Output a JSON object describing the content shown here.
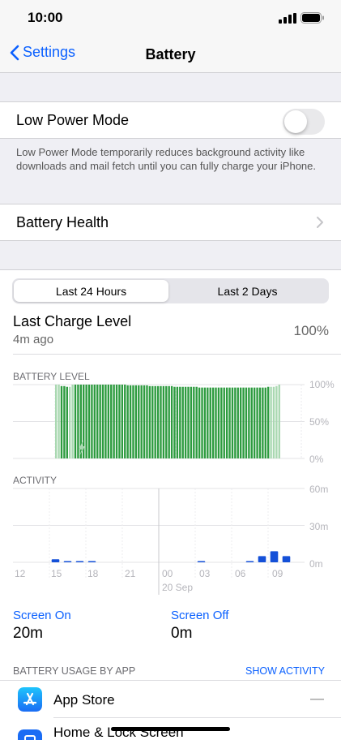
{
  "status_bar": {
    "time": "10:00"
  },
  "nav": {
    "back_label": "Settings",
    "title": "Battery"
  },
  "low_power": {
    "label": "Low Power Mode",
    "enabled": false,
    "footnote": "Low Power Mode temporarily reduces background activity like downloads and mail fetch until you can fully charge your iPhone."
  },
  "battery_health": {
    "label": "Battery Health"
  },
  "segment": {
    "options": [
      "Last 24 Hours",
      "Last 2 Days"
    ],
    "selected": 0
  },
  "last_charge": {
    "label": "Last Charge Level",
    "ago": "4m ago",
    "value": "100%"
  },
  "battery_level_chart": {
    "title": "BATTERY LEVEL",
    "y_ticks": [
      "100%",
      "50%",
      "0%"
    ],
    "levels_pct": [
      100,
      100,
      98,
      98,
      97,
      97,
      100,
      100,
      100,
      100,
      100,
      100,
      100,
      100,
      100,
      100,
      100,
      100,
      100,
      100,
      100,
      100,
      100,
      100,
      100,
      100,
      99,
      99,
      99,
      99,
      99,
      99,
      99,
      99,
      98,
      98,
      98,
      98,
      98,
      98,
      98,
      98,
      98,
      97,
      97,
      97,
      97,
      97,
      97,
      97,
      97,
      97,
      96,
      96,
      96,
      96,
      96,
      96,
      96,
      96,
      96,
      96,
      96,
      96,
      96,
      96,
      96,
      96,
      96,
      96,
      96,
      96,
      96,
      96,
      96,
      96,
      96,
      97,
      97,
      97,
      98,
      100
    ],
    "charging_segments": [
      [
        0,
        1
      ],
      [
        5,
        6
      ],
      [
        78,
        81
      ]
    ]
  },
  "activity_chart": {
    "title": "ACTIVITY",
    "y_ticks": [
      "60m",
      "30m",
      "0m"
    ],
    "x_ticks": [
      "12",
      "15",
      "18",
      "21",
      "00",
      "03",
      "06",
      "09"
    ],
    "date_label": "20 Sep",
    "ymax_minutes": 60,
    "hours": [
      "12",
      "13",
      "14",
      "15",
      "16",
      "17",
      "18",
      "19",
      "20",
      "21",
      "22",
      "23",
      "00",
      "01",
      "02",
      "03",
      "04",
      "05",
      "06",
      "07",
      "08",
      "09",
      "10"
    ],
    "screen_on_minutes": [
      0,
      0,
      0,
      2.5,
      1,
      1,
      1,
      0,
      0,
      0,
      0,
      0,
      0,
      0,
      0,
      1,
      0,
      0,
      0,
      1,
      5,
      9,
      5
    ]
  },
  "screen_time": {
    "on_label": "Screen On",
    "on_value": "20m",
    "off_label": "Screen Off",
    "off_value": "0m"
  },
  "usage": {
    "title": "BATTERY USAGE BY APP",
    "show_activity": "SHOW ACTIVITY",
    "apps": [
      {
        "name": "App Store",
        "value": "—",
        "icon": "app-store-icon"
      },
      {
        "name": "Home & Lock Screen",
        "value": "",
        "icon": "home-screen-icon"
      }
    ]
  },
  "colors": {
    "accent": "#0a60ff",
    "battery_green": "#2d9b3f",
    "activity_blue": "#1450d8"
  }
}
